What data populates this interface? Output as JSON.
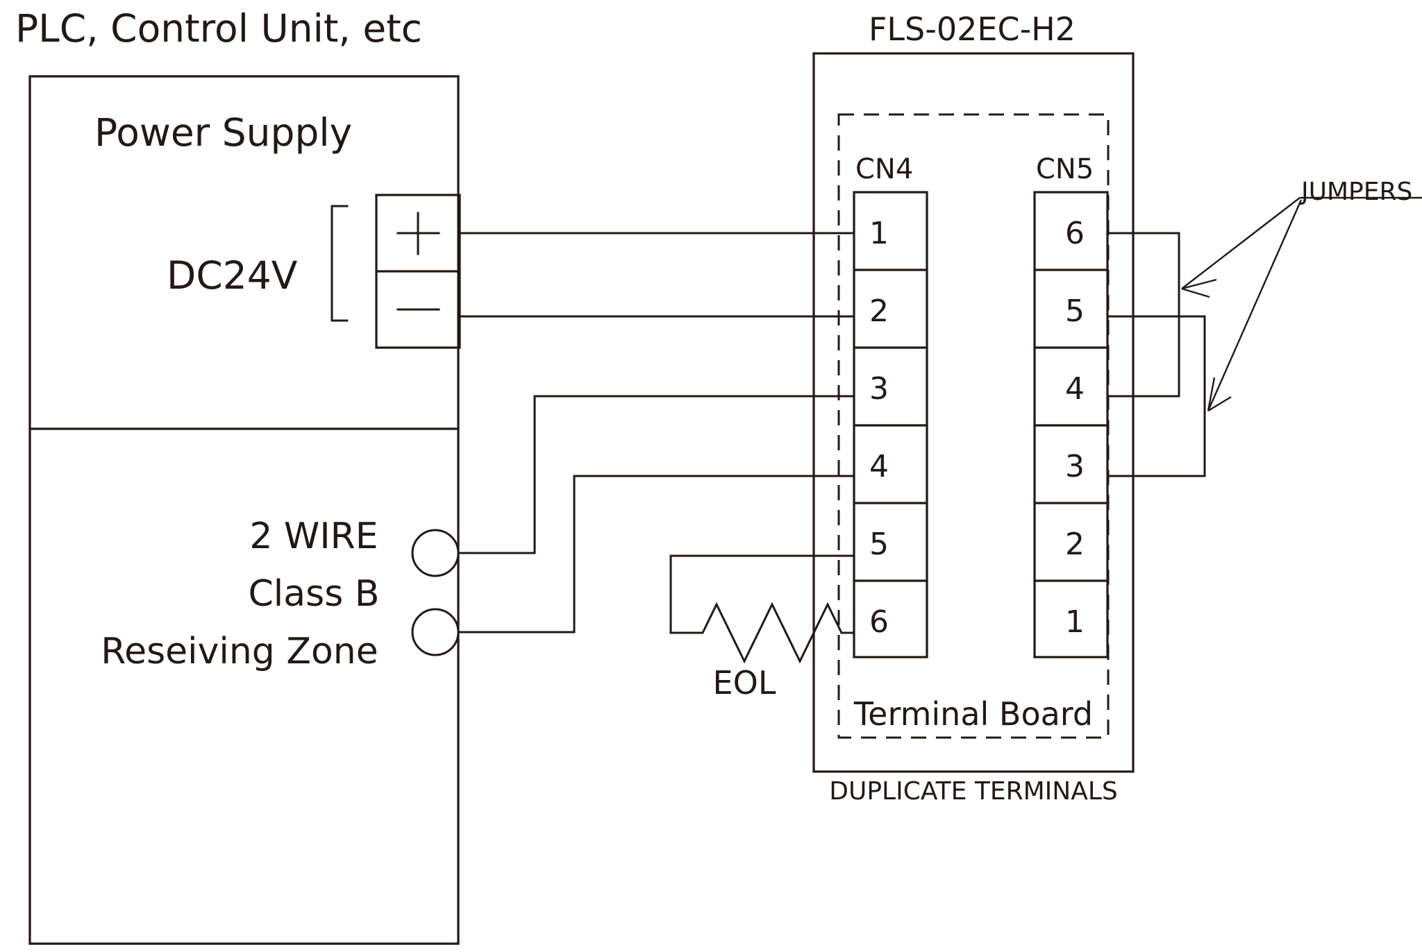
{
  "diagram": {
    "title_left": "PLC, Control Unit, etc",
    "device_label": "FLS-02EC-H2",
    "duplicate_terminals_label": "DUPLICATE TERMINALS",
    "jumpers_label": "JUMPERS",
    "terminal_board_label": "Terminal Board",
    "eol_label": "EOL",
    "line_color": "#231815",
    "background_color": "#FFFFFF"
  },
  "panel": {
    "power_supply_label": "Power Supply",
    "dc_label": "DC24V",
    "terminal_plus": "+",
    "terminal_minus": "−",
    "zone_lines": [
      "2 WIRE",
      "Class B",
      "Reseiving Zone"
    ]
  },
  "connectors": [
    {
      "name": "CN4",
      "terminals": [
        "1",
        "2",
        "3",
        "4",
        "5",
        "6"
      ]
    },
    {
      "name": "CN5",
      "terminals": [
        "6",
        "5",
        "4",
        "3",
        "2",
        "1"
      ]
    }
  ],
  "wires": [
    {
      "id": "w1",
      "from": "PowerSupply +",
      "to": "CN4-1"
    },
    {
      "id": "w2",
      "from": "PowerSupply −",
      "to": "CN4-2"
    },
    {
      "id": "w3",
      "from": "Zone terminal 1",
      "to": "CN4-3"
    },
    {
      "id": "w4",
      "from": "Zone terminal 2",
      "to": "CN4-4"
    },
    {
      "id": "w5",
      "from": "CN4-5",
      "to": "EOL resistor"
    },
    {
      "id": "w6",
      "from": "EOL resistor",
      "to": "CN4-6"
    }
  ],
  "jumpers": [
    {
      "id": "j1",
      "from": "CN5-6",
      "to": "CN5-4"
    },
    {
      "id": "j2",
      "from": "CN5-5",
      "to": "CN5-3"
    }
  ]
}
